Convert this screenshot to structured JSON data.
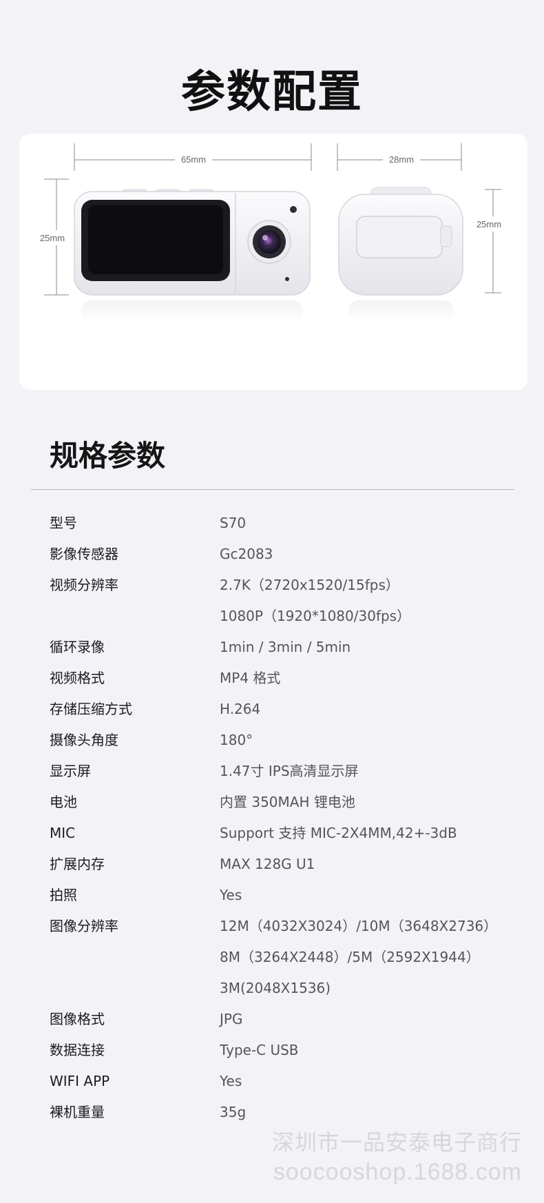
{
  "header": {
    "title": "参数配置"
  },
  "dimensions": {
    "front_width": "65mm",
    "front_height": "25mm",
    "side_width": "28mm",
    "side_height": "25mm"
  },
  "specs": {
    "title": "规格参数",
    "rows": [
      {
        "label": "型号",
        "values": [
          "S70"
        ]
      },
      {
        "label": "影像传感器",
        "values": [
          "Gc2083"
        ]
      },
      {
        "label": "视频分辨率",
        "values": [
          "2.7K（2720x1520/15fps）",
          "1080P（1920*1080/30fps）"
        ]
      },
      {
        "label": "循环录像",
        "values": [
          "1min / 3min / 5min"
        ]
      },
      {
        "label": "视频格式",
        "values": [
          "MP4 格式"
        ]
      },
      {
        "label": "存储压缩方式",
        "values": [
          "H.264"
        ]
      },
      {
        "label": "摄像头角度",
        "values": [
          "180°"
        ]
      },
      {
        "label": "显示屏",
        "values": [
          "1.47寸 IPS高清显示屏"
        ]
      },
      {
        "label": "电池",
        "values": [
          "内置 350MAH 锂电池"
        ]
      },
      {
        "label": "MIC",
        "values": [
          "Support 支持  MIC-2X4MM,42+-3dB"
        ]
      },
      {
        "label": "扩展内存",
        "values": [
          "MAX 128G   U1"
        ]
      },
      {
        "label": "拍照",
        "values": [
          "Yes"
        ]
      },
      {
        "label": "图像分辨率",
        "values": [
          "12M（4032X3024）/10M（3648X2736）",
          "8M（3264X2448）/5M（2592X1944）",
          "3M(2048X1536)"
        ]
      },
      {
        "label": "图像格式",
        "values": [
          "JPG"
        ]
      },
      {
        "label": "数据连接",
        "values": [
          "Type-C USB"
        ]
      },
      {
        "label": "WIFI  APP",
        "values": [
          "Yes"
        ]
      },
      {
        "label": "裸机重量",
        "values": [
          "35g"
        ]
      }
    ]
  },
  "watermark": {
    "line1": "深圳市一品安泰电子商行",
    "line2": "soocooshop.1688.com"
  }
}
